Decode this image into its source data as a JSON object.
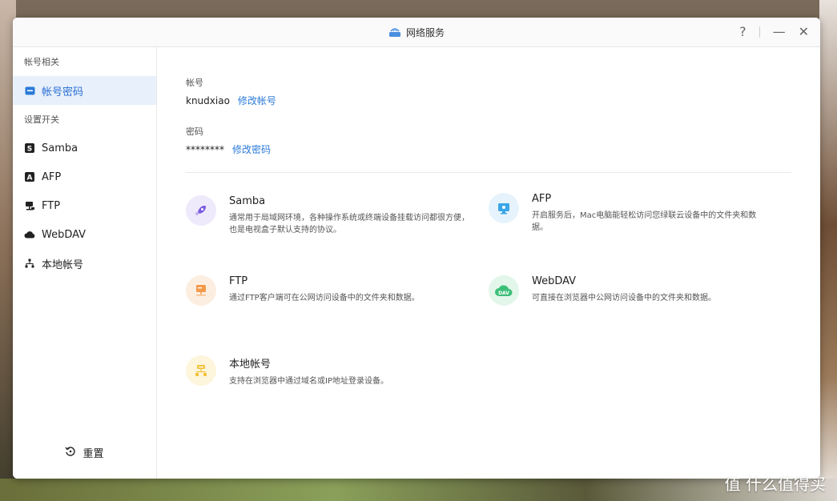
{
  "window": {
    "title": "网络服务",
    "help": "?",
    "minimize": "—",
    "close": "✕"
  },
  "sidebar": {
    "group1": "帐号相关",
    "item_account": "帐号密码",
    "group2": "设置开关",
    "items": [
      {
        "label": "Samba",
        "icon": "samba-icon"
      },
      {
        "label": "AFP",
        "icon": "afp-icon"
      },
      {
        "label": "FTP",
        "icon": "ftp-icon"
      },
      {
        "label": "WebDAV",
        "icon": "cloud-icon"
      },
      {
        "label": "本地帐号",
        "icon": "network-icon"
      }
    ],
    "reset": "重置"
  },
  "account": {
    "username_label": "帐号",
    "username": "knudxiao",
    "change_username": "修改帐号",
    "password_label": "密码",
    "password": "********",
    "change_password": "修改密码"
  },
  "services": [
    {
      "title": "Samba",
      "desc": "通常用于局域网环境，各种操作系统或终端设备挂载访问都很方便，也是电视盒子默认支持的协议。"
    },
    {
      "title": "AFP",
      "desc": "开启服务后，Mac电脑能轻松访问您绿联云设备中的文件夹和数据。"
    },
    {
      "title": "FTP",
      "desc": "通过FTP客户端可在公网访问设备中的文件夹和数据。"
    },
    {
      "title": "WebDAV",
      "desc": "可直接在浏览器中公网访问设备中的文件夹和数据。"
    },
    {
      "title": "本地帐号",
      "desc": "支持在浏览器中通过域名或IP地址登录设备。"
    }
  ],
  "watermark": "值 什么值得买",
  "colors": {
    "accent": "#2a7ad8",
    "active_bg": "#e8f0fb"
  }
}
